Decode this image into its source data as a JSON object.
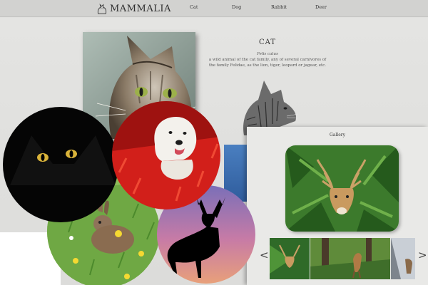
{
  "brand": {
    "name": "MAMMALIA",
    "logo_icon": "cat-logo-icon"
  },
  "nav": [
    {
      "label": "Cat"
    },
    {
      "label": "Dog"
    },
    {
      "label": "Rabbit"
    },
    {
      "label": "Deer"
    }
  ],
  "info": {
    "title": "CAT",
    "scientific_name": "Felis catus",
    "description": "a wild animal of the cat family, any of several carnivores of the family Felidae, as the lion, tiger, leopard or jaguar, etc."
  },
  "gallery": {
    "title": "Gallery",
    "prev_label": "<",
    "next_label": ">"
  }
}
